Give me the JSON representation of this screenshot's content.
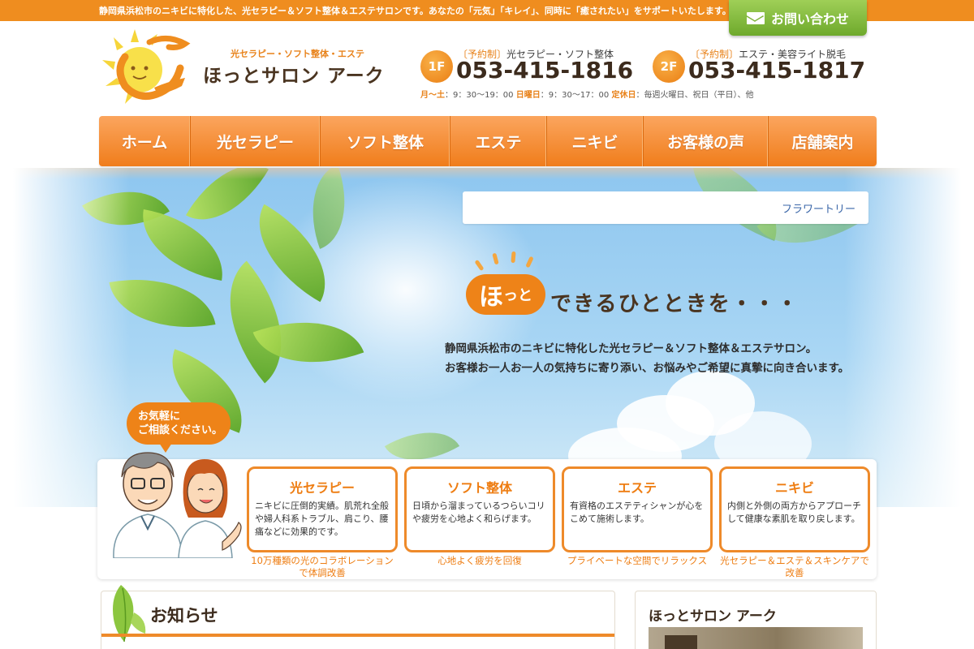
{
  "topbar": {
    "tagline": "静岡県浜松市のニキビに特化した、光セラピー＆ソフト整体＆エステサロンです。あなたの「元気」「キレイ」、同時に「癒されたい」をサポートいたします。",
    "contact_label": "お問い合わせ"
  },
  "logo": {
    "sub": "光セラピー・ソフト整体・エステ",
    "name": "ほっとサロン アーク"
  },
  "tel1": {
    "floor": "1F",
    "tag": "〔予約制〕",
    "label": "光セラピー・ソフト整体",
    "number": "053-415-1816"
  },
  "tel2": {
    "floor": "2F",
    "tag": "〔予約制〕",
    "label": "エステ・美容ライト脱毛",
    "number": "053-415-1817"
  },
  "hours": {
    "weekday_label": "月～土",
    "weekday": "：9：30～19：00",
    "sunday_label": "日曜日",
    "sunday": "：9：30～17：00",
    "holiday_label": "定休日",
    "holiday": "：毎週火曜日、祝日（平日）、他"
  },
  "nav": [
    {
      "label": "ホーム"
    },
    {
      "label": "光セラピー"
    },
    {
      "label": "ソフト整体"
    },
    {
      "label": "エステ"
    },
    {
      "label": "ニキビ"
    },
    {
      "label": "お客様の声"
    },
    {
      "label": "店舗案内"
    }
  ],
  "hero": {
    "search_link": "フラワートリー",
    "bubble_main": "ほ",
    "bubble_small": "っと",
    "catch": "できるひとときを・・・",
    "desc_line1": "静岡県浜松市のニキビに特化した光セラピー＆ソフト整体＆エステサロン。",
    "desc_line2": "お客様お一人お一人の気持ちに寄り添い、お悩みやご希望に真摯に向き合います。"
  },
  "consult": {
    "line1": "お気軽に",
    "line2": "ご相談ください。"
  },
  "services": [
    {
      "title": "光セラピー",
      "text": "ニキビに圧倒的実績。肌荒れ全般や婦人科系トラブル、肩こり、腰痛などに効果的です。",
      "sub": "10万種類の光のコラボレーションで体調改善"
    },
    {
      "title": "ソフト整体",
      "text": "日頃から溜まっているつらいコリや疲労を心地よく和らげます。",
      "sub": "心地よく疲労を回復"
    },
    {
      "title": "エステ",
      "text": "有資格のエステティシャンが心をこめて施術します。",
      "sub": "プライベートな空間でリラックス"
    },
    {
      "title": "ニキビ",
      "text": "内側と外側の両方からアプローチして健康な素肌を取り戻します。",
      "sub": "光セラピー＆エステ＆スキンケアで改善"
    }
  ],
  "news": {
    "title": "お知らせ"
  },
  "side": {
    "title": "ほっとサロン アーク"
  },
  "colors": {
    "orange": "#ee8318",
    "green": "#7fb43a",
    "brown": "#3c2b1d"
  }
}
